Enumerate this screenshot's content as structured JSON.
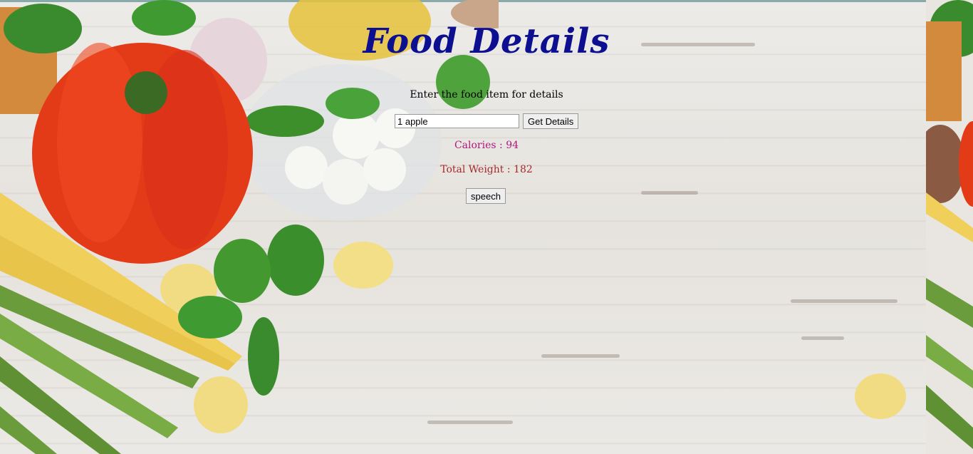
{
  "page": {
    "title": "Food Details",
    "prompt": "Enter the food item for details"
  },
  "form": {
    "food_value": "1 apple",
    "submit_label": "Get Details"
  },
  "results": {
    "calories": "Calories : 94",
    "total_weight": "Total Weight : 182"
  },
  "speech": {
    "label": "speech"
  },
  "colors": {
    "title": "#0c0f8f",
    "calories": "#b0177a",
    "weight": "#a42a2a"
  }
}
